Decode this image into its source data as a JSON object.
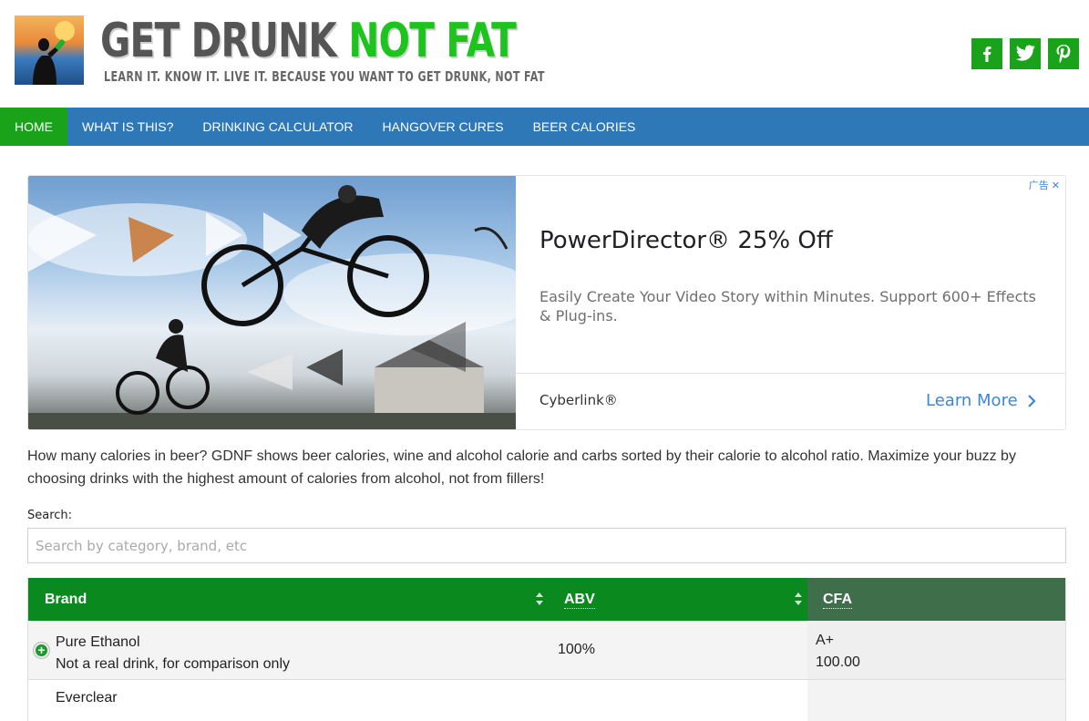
{
  "header": {
    "title_part1": "GET DRUNK",
    "title_part2": "NOT FAT",
    "tagline": "LEARN IT. KNOW IT. LIVE IT. BECAUSE YOU WANT TO GET DRUNK, NOT FAT",
    "social": [
      {
        "icon": "facebook-icon",
        "glyph": "f"
      },
      {
        "icon": "twitter-icon",
        "glyph": "t"
      },
      {
        "icon": "pinterest-icon",
        "glyph": "p"
      }
    ],
    "brand_color": "#1aa31a"
  },
  "nav": {
    "color": "#2f78b8",
    "active_color": "#1aa31a",
    "items": [
      {
        "label": "HOME",
        "active": true
      },
      {
        "label": "WHAT IS THIS?",
        "active": false
      },
      {
        "label": "DRINKING CALCULATOR",
        "active": false
      },
      {
        "label": "HANGOVER CURES",
        "active": false
      },
      {
        "label": "BEER CALORIES",
        "active": false
      }
    ]
  },
  "ad": {
    "badge": "广告",
    "title": "PowerDirector® 25% Off",
    "description": "Easily Create Your Video Story within Minutes. Support 600+ Effects & Plug-ins.",
    "sponsor": "Cyberlink®",
    "cta": "Learn More"
  },
  "intro": "How many calories in beer? GDNF shows beer calories, wine and alcohol calorie and carbs sorted by their calorie to alcohol ratio. Maximize your buzz by choosing drinks with the highest amount of calories from alcohol, not from fillers!",
  "search": {
    "label": "Search:",
    "placeholder": "Search by category, brand, etc",
    "value": ""
  },
  "table": {
    "columns": [
      "Brand",
      "ABV",
      "CFA"
    ],
    "rows": [
      {
        "brand": "Pure Ethanol",
        "note": "Not a real drink, for comparison only",
        "abv": "100%",
        "grade": "A+",
        "cfa": "100.00"
      },
      {
        "brand": "Everclear",
        "note": "",
        "abv": "",
        "grade": "",
        "cfa": ""
      }
    ]
  }
}
